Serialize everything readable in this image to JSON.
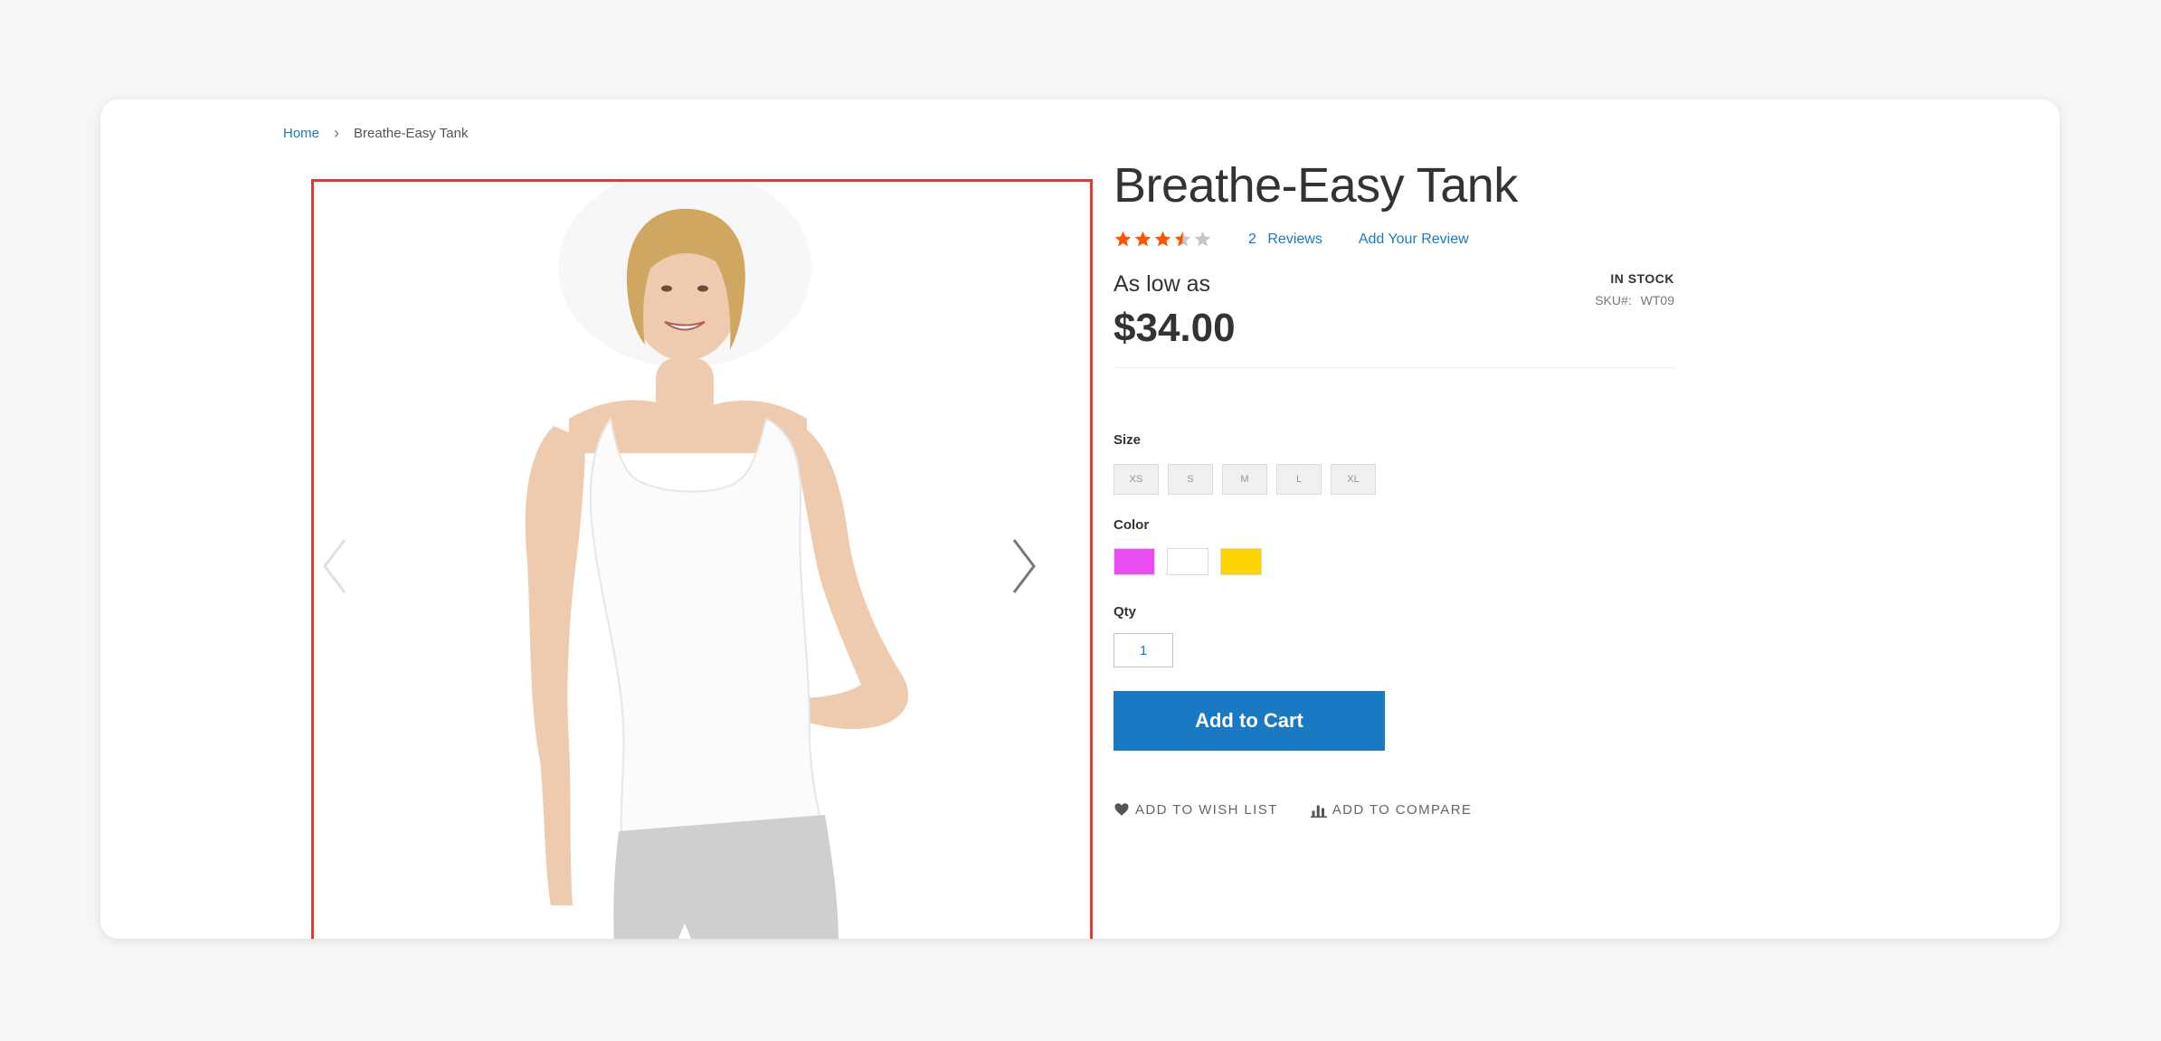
{
  "breadcrumb": {
    "home": "Home",
    "separator": "›",
    "current": "Breathe-Easy Tank"
  },
  "gallery": {
    "highlight_color": "#e53935",
    "prev_icon": "chevron-left-icon",
    "next_icon": "chevron-right-icon"
  },
  "product": {
    "title": "Breathe-Easy Tank",
    "rating_stars": 3.5,
    "rating_max": 5,
    "reviews_count": "2",
    "reviews_label": "Reviews",
    "add_review": "Add Your Review",
    "price_prefix": "As low as",
    "price": "$34.00",
    "stock": "IN STOCK",
    "sku_label": "SKU#:",
    "sku": "WT09"
  },
  "options": {
    "size_label": "Size",
    "sizes": [
      "XS",
      "S",
      "M",
      "L",
      "XL"
    ],
    "color_label": "Color",
    "colors": [
      "#e84cf2",
      "#ffffff",
      "#ffd500"
    ],
    "qty_label": "Qty",
    "qty_value": "1"
  },
  "actions": {
    "add_to_cart": "Add to Cart",
    "wishlist": "ADD TO WISH LIST",
    "compare": "ADD TO COMPARE"
  },
  "colors": {
    "accent": "#1979c3",
    "star_filled": "#ff5501",
    "star_empty": "#c7c7c7"
  }
}
